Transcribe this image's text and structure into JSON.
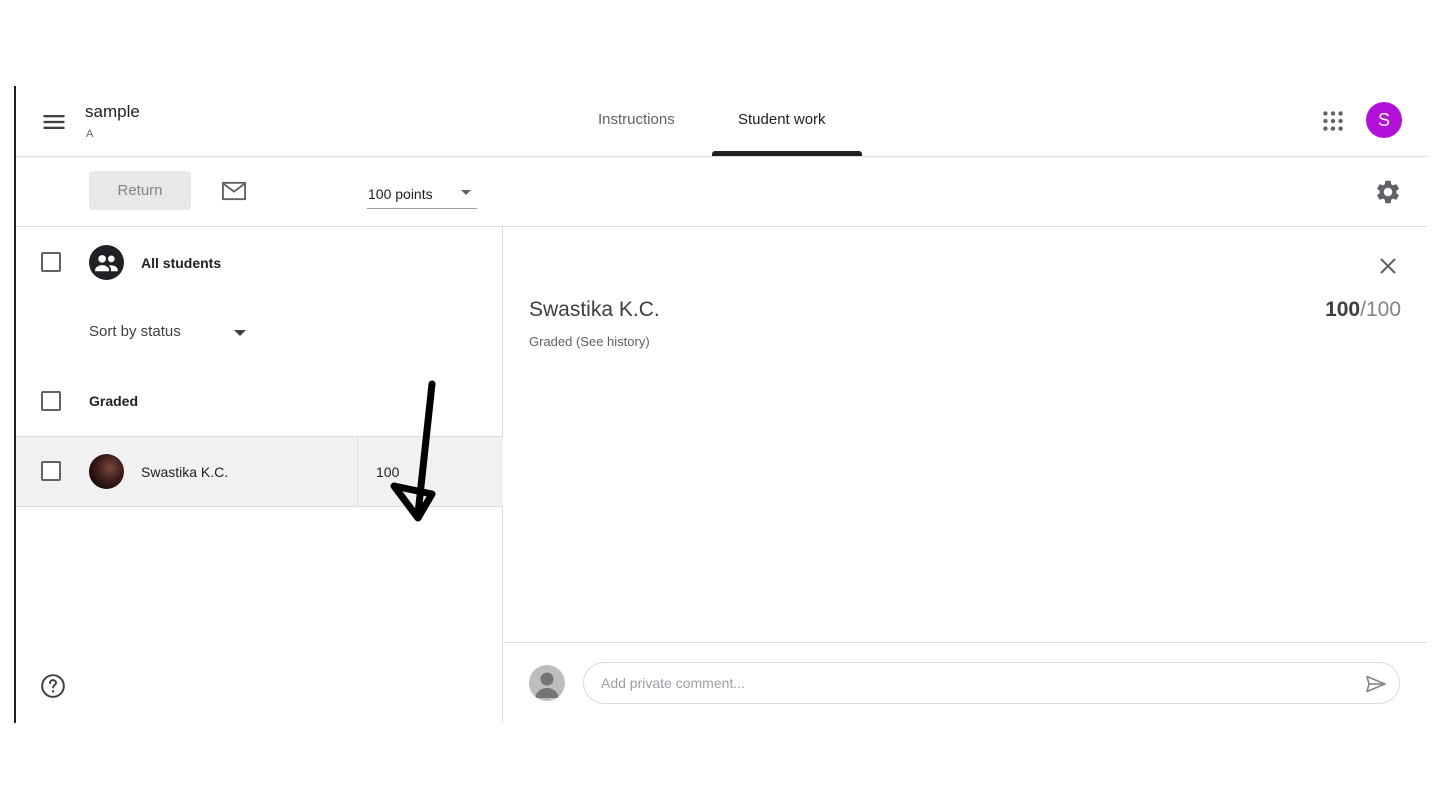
{
  "header": {
    "title": "sample",
    "subtitle": "A",
    "tabs": [
      {
        "label": "Instructions",
        "active": false
      },
      {
        "label": "Student work",
        "active": true
      }
    ],
    "account_initial": "S",
    "account_color": "#b210d8"
  },
  "toolbar": {
    "return_label": "Return",
    "points_value": "100 points"
  },
  "student_list": {
    "all_students_label": "All students",
    "sort_label": "Sort by status",
    "section_heading": "Graded",
    "students": [
      {
        "name": "Swastika K.C.",
        "grade": "100",
        "selected": true
      }
    ]
  },
  "detail": {
    "student_name": "Swastika K.C.",
    "status": "Graded (See history)",
    "score": "100",
    "score_total": "/100",
    "comment_placeholder": "Add private comment..."
  },
  "icons": [
    "menu-icon",
    "apps-grid-icon",
    "mail-icon",
    "gear-icon",
    "group-icon",
    "help-icon",
    "close-icon",
    "send-icon",
    "annotation-arrow"
  ]
}
